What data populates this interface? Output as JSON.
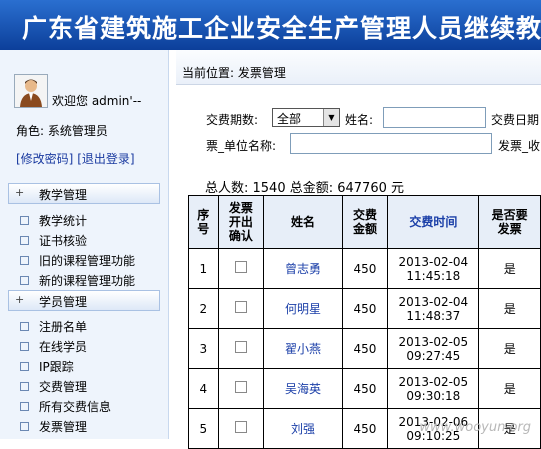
{
  "header": {
    "title": "广东省建筑施工企业安全生产管理人员继续教"
  },
  "sidebar": {
    "welcome": "欢迎您 admin'--",
    "role": "角色: 系统管理员",
    "change_password": "[修改密码]",
    "logout": "[退出登录]",
    "sections": [
      {
        "label": "教学管理",
        "items": [
          "教学统计",
          "证书核验",
          "旧的课程管理功能",
          "新的课程管理功能"
        ]
      },
      {
        "label": "学员管理",
        "items": [
          "注册名单",
          "在线学员",
          "IP跟踪",
          "交费管理",
          "所有交费信息",
          "发票管理"
        ]
      }
    ]
  },
  "main": {
    "breadcrumb": "当前位置: 发票管理",
    "filters": {
      "period_label": "交费期数:",
      "period_value": "全部",
      "name_label": "姓名:",
      "pay_date_label": "交费日期",
      "invoice_unit_label": "票_单位名称:",
      "invoice_recv_label": "发票_收"
    },
    "summary": "总人数: 1540   总金额: 647760 元",
    "table": {
      "headers": [
        "序号",
        "发票开出确认",
        "姓名",
        "交费金额",
        "交费时间",
        "是否要发票"
      ],
      "rows": [
        {
          "no": "1",
          "name": "曾志勇",
          "amount": "450",
          "date": "2013-02-04",
          "time": "11:45:18",
          "invoice": "是"
        },
        {
          "no": "2",
          "name": "何明星",
          "amount": "450",
          "date": "2013-02-04",
          "time": "11:48:37",
          "invoice": "是"
        },
        {
          "no": "3",
          "name": "翟小燕",
          "amount": "450",
          "date": "2013-02-05",
          "time": "09:27:45",
          "invoice": "是"
        },
        {
          "no": "4",
          "name": "吴海英",
          "amount": "450",
          "date": "2013-02-05",
          "time": "09:30:18",
          "invoice": "是"
        },
        {
          "no": "5",
          "name": "刘强",
          "amount": "450",
          "date": "2013-02-06",
          "time": "09:10:25",
          "invoice": "是"
        }
      ]
    }
  },
  "watermark": "www.wooyun.org"
}
